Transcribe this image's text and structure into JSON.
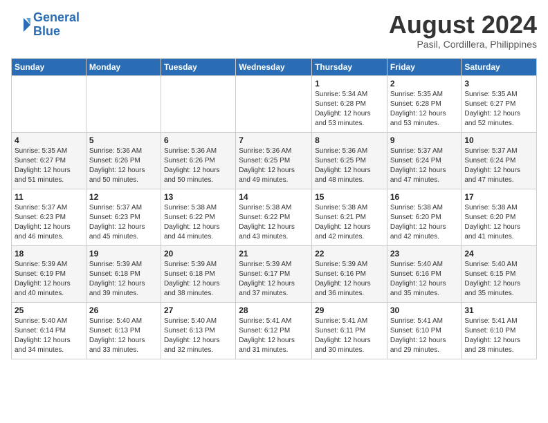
{
  "logo": {
    "line1": "General",
    "line2": "Blue"
  },
  "title": "August 2024",
  "subtitle": "Pasil, Cordillera, Philippines",
  "days_of_week": [
    "Sunday",
    "Monday",
    "Tuesday",
    "Wednesday",
    "Thursday",
    "Friday",
    "Saturday"
  ],
  "weeks": [
    [
      {
        "day": "",
        "info": ""
      },
      {
        "day": "",
        "info": ""
      },
      {
        "day": "",
        "info": ""
      },
      {
        "day": "",
        "info": ""
      },
      {
        "day": "1",
        "info": "Sunrise: 5:34 AM\nSunset: 6:28 PM\nDaylight: 12 hours\nand 53 minutes."
      },
      {
        "day": "2",
        "info": "Sunrise: 5:35 AM\nSunset: 6:28 PM\nDaylight: 12 hours\nand 53 minutes."
      },
      {
        "day": "3",
        "info": "Sunrise: 5:35 AM\nSunset: 6:27 PM\nDaylight: 12 hours\nand 52 minutes."
      }
    ],
    [
      {
        "day": "4",
        "info": "Sunrise: 5:35 AM\nSunset: 6:27 PM\nDaylight: 12 hours\nand 51 minutes."
      },
      {
        "day": "5",
        "info": "Sunrise: 5:36 AM\nSunset: 6:26 PM\nDaylight: 12 hours\nand 50 minutes."
      },
      {
        "day": "6",
        "info": "Sunrise: 5:36 AM\nSunset: 6:26 PM\nDaylight: 12 hours\nand 50 minutes."
      },
      {
        "day": "7",
        "info": "Sunrise: 5:36 AM\nSunset: 6:25 PM\nDaylight: 12 hours\nand 49 minutes."
      },
      {
        "day": "8",
        "info": "Sunrise: 5:36 AM\nSunset: 6:25 PM\nDaylight: 12 hours\nand 48 minutes."
      },
      {
        "day": "9",
        "info": "Sunrise: 5:37 AM\nSunset: 6:24 PM\nDaylight: 12 hours\nand 47 minutes."
      },
      {
        "day": "10",
        "info": "Sunrise: 5:37 AM\nSunset: 6:24 PM\nDaylight: 12 hours\nand 47 minutes."
      }
    ],
    [
      {
        "day": "11",
        "info": "Sunrise: 5:37 AM\nSunset: 6:23 PM\nDaylight: 12 hours\nand 46 minutes."
      },
      {
        "day": "12",
        "info": "Sunrise: 5:37 AM\nSunset: 6:23 PM\nDaylight: 12 hours\nand 45 minutes."
      },
      {
        "day": "13",
        "info": "Sunrise: 5:38 AM\nSunset: 6:22 PM\nDaylight: 12 hours\nand 44 minutes."
      },
      {
        "day": "14",
        "info": "Sunrise: 5:38 AM\nSunset: 6:22 PM\nDaylight: 12 hours\nand 43 minutes."
      },
      {
        "day": "15",
        "info": "Sunrise: 5:38 AM\nSunset: 6:21 PM\nDaylight: 12 hours\nand 42 minutes."
      },
      {
        "day": "16",
        "info": "Sunrise: 5:38 AM\nSunset: 6:20 PM\nDaylight: 12 hours\nand 42 minutes."
      },
      {
        "day": "17",
        "info": "Sunrise: 5:38 AM\nSunset: 6:20 PM\nDaylight: 12 hours\nand 41 minutes."
      }
    ],
    [
      {
        "day": "18",
        "info": "Sunrise: 5:39 AM\nSunset: 6:19 PM\nDaylight: 12 hours\nand 40 minutes."
      },
      {
        "day": "19",
        "info": "Sunrise: 5:39 AM\nSunset: 6:18 PM\nDaylight: 12 hours\nand 39 minutes."
      },
      {
        "day": "20",
        "info": "Sunrise: 5:39 AM\nSunset: 6:18 PM\nDaylight: 12 hours\nand 38 minutes."
      },
      {
        "day": "21",
        "info": "Sunrise: 5:39 AM\nSunset: 6:17 PM\nDaylight: 12 hours\nand 37 minutes."
      },
      {
        "day": "22",
        "info": "Sunrise: 5:39 AM\nSunset: 6:16 PM\nDaylight: 12 hours\nand 36 minutes."
      },
      {
        "day": "23",
        "info": "Sunrise: 5:40 AM\nSunset: 6:16 PM\nDaylight: 12 hours\nand 35 minutes."
      },
      {
        "day": "24",
        "info": "Sunrise: 5:40 AM\nSunset: 6:15 PM\nDaylight: 12 hours\nand 35 minutes."
      }
    ],
    [
      {
        "day": "25",
        "info": "Sunrise: 5:40 AM\nSunset: 6:14 PM\nDaylight: 12 hours\nand 34 minutes."
      },
      {
        "day": "26",
        "info": "Sunrise: 5:40 AM\nSunset: 6:13 PM\nDaylight: 12 hours\nand 33 minutes."
      },
      {
        "day": "27",
        "info": "Sunrise: 5:40 AM\nSunset: 6:13 PM\nDaylight: 12 hours\nand 32 minutes."
      },
      {
        "day": "28",
        "info": "Sunrise: 5:41 AM\nSunset: 6:12 PM\nDaylight: 12 hours\nand 31 minutes."
      },
      {
        "day": "29",
        "info": "Sunrise: 5:41 AM\nSunset: 6:11 PM\nDaylight: 12 hours\nand 30 minutes."
      },
      {
        "day": "30",
        "info": "Sunrise: 5:41 AM\nSunset: 6:10 PM\nDaylight: 12 hours\nand 29 minutes."
      },
      {
        "day": "31",
        "info": "Sunrise: 5:41 AM\nSunset: 6:10 PM\nDaylight: 12 hours\nand 28 minutes."
      }
    ]
  ]
}
